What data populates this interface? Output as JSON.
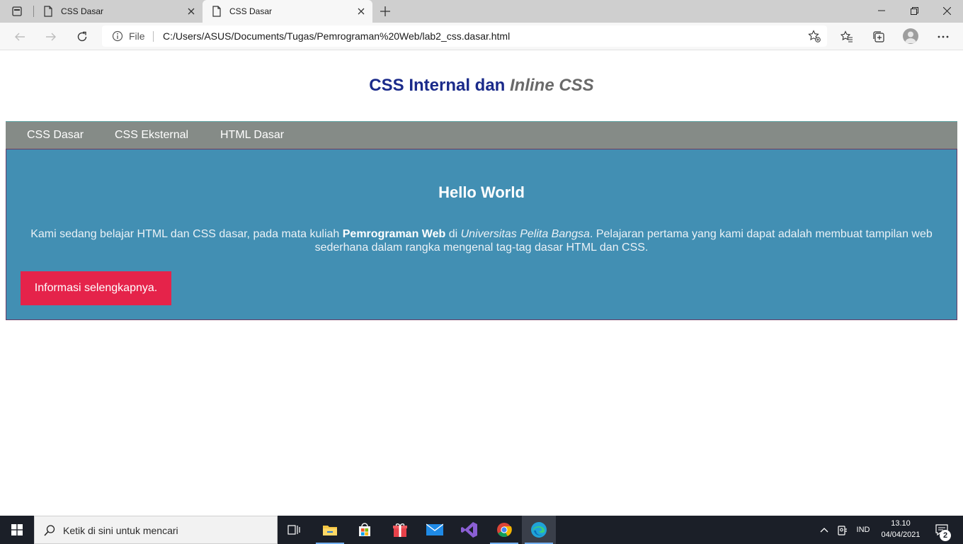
{
  "browser": {
    "tabs": [
      {
        "title": "CSS Dasar",
        "active": false
      },
      {
        "title": "CSS Dasar",
        "active": true
      }
    ],
    "address": {
      "scheme_label": "File",
      "url": "C:/Users/ASUS/Documents/Tugas/Pemrograman%20Web/lab2_css.dasar.html"
    },
    "icons": {
      "tab_actions": "tab-actions-icon",
      "page": "page-icon",
      "close": "close-icon",
      "new_tab": "plus-icon",
      "back": "back-arrow-icon",
      "forward": "forward-arrow-icon",
      "refresh": "refresh-icon",
      "info": "info-icon",
      "add_favorite": "star-plus-icon",
      "favorites": "favorites-icon",
      "collections": "collections-icon",
      "profile": "profile-avatar",
      "menu": "more-icon",
      "minimize": "minimize-icon",
      "restore": "restore-icon",
      "close_window": "close-icon"
    }
  },
  "page": {
    "header": {
      "part1": "CSS Internal dan ",
      "part2_italic": "Inline CSS"
    },
    "nav": [
      "CSS Dasar",
      "CSS Eksternal",
      "HTML Dasar"
    ],
    "hero": {
      "title": "Hello World",
      "text_before_bold": "Kami sedang belajar HTML dan CSS dasar, pada mata kuliah ",
      "bold": "Pemrograman Web",
      "text_between": " di ",
      "italic": "Universitas Pelita Bangsa",
      "text_after": ". Pelajaran pertama yang kami dapat adalah membuat tampilan web sederhana dalam rangka mengenal tag-tag dasar HTML dan CSS.",
      "button_label": "Informasi selengkapnya."
    },
    "colors": {
      "header": "#1a2a8a",
      "nav_bg": "#858b87",
      "hero_bg": "#428fb3",
      "button_bg": "#e5234a"
    }
  },
  "taskbar": {
    "search_placeholder": "Ketik di sini untuk mencari",
    "apps": [
      "task-view-icon",
      "file-explorer-icon",
      "store-icon",
      "gift-app-icon",
      "mail-icon",
      "visual-studio-icon",
      "chrome-icon",
      "edge-icon"
    ],
    "tray": {
      "language": "IND",
      "time": "13.10",
      "date": "04/04/2021",
      "notification_count": "2"
    }
  }
}
